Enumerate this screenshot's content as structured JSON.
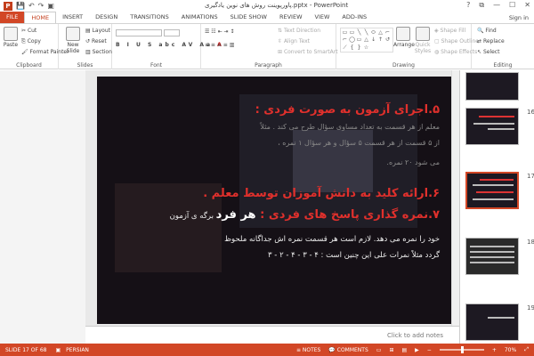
{
  "window": {
    "title": "پاورپوینت روش های نوین یادگیری.pptx - PowerPoint",
    "controls": [
      "?",
      "⧉",
      "—",
      "☐",
      "✕"
    ],
    "sign_in": "Sign in"
  },
  "qat": {
    "app_icon": "P",
    "save": "💾",
    "undo": "↶",
    "redo": "↷",
    "present": "▣"
  },
  "tabs": [
    "FILE",
    "HOME",
    "INSERT",
    "DESIGN",
    "TRANSITIONS",
    "ANIMATIONS",
    "SLIDE SHOW",
    "REVIEW",
    "VIEW",
    "ADD-INS"
  ],
  "ribbon": {
    "clipboard": {
      "paste": "Paste",
      "cut": "Cut",
      "copy": "Copy",
      "format_painter": "Format Painter",
      "label": "Clipboard"
    },
    "slides": {
      "new_slide": "New Slide",
      "layout": "Layout",
      "reset": "Reset",
      "section": "Section",
      "label": "Slides"
    },
    "font": {
      "label": "Font",
      "format_buttons": [
        "B",
        "I",
        "U",
        "S",
        "abc",
        "AV",
        "Aa",
        "A"
      ]
    },
    "paragraph": {
      "text_direction": "Text Direction",
      "align_text": "Align Text",
      "convert_smartart": "Convert to SmartArt",
      "label": "Paragraph"
    },
    "drawing": {
      "arrange": "Arrange",
      "quick_styles": "Quick Styles",
      "shape_fill": "Shape Fill",
      "shape_outline": "Shape Outline",
      "shape_effects": "Shape Effects",
      "label": "Drawing",
      "shapes": [
        "▭",
        "▭",
        "╲",
        "╲",
        "⬭",
        "△",
        "⌐",
        "⌐",
        "◯",
        "▭",
        "△",
        "↓",
        "↑",
        "↺",
        "⟋",
        "{",
        "}",
        "☆"
      ]
    },
    "editing": {
      "find": "Find",
      "replace": "Replace",
      "select": "Select",
      "label": "Editing"
    }
  },
  "slide": {
    "lines": [
      {
        "text": "۵.اجرای آزمون به صورت فردی :",
        "style": "red"
      },
      {
        "text": "معلم از هر قسمت به تعداد مساوی سؤال طرح می کند . مثلاً",
        "style": "grey"
      },
      {
        "text": "از ۵ قسمت از هر قسمت ۵ سؤال و هر سؤال ۱ نمره ،",
        "style": "grey"
      },
      {
        "text": "می شود ۲۰ نمره.",
        "style": "grey"
      },
      {
        "text": "۶.ارائه کلید به دانش آموزان توسط معلم .",
        "style": "red"
      },
      {
        "text": "۷.نمره گذاری پاسخ های فردی : هر فرد برگه ی آزمون",
        "style": "red-mixed"
      },
      {
        "text": "خود را نمره می دهد. لازم است هر قسمت نمره اش جداگانه ملحوظ",
        "style": "white"
      },
      {
        "text": "گردد مثلاً نمرات علی این چنین است : ۴ - ۳ - ۴ - ۲ - ۳",
        "style": "white"
      }
    ],
    "line7_red": "۷.نمره گذاری پاسخ های فردی :",
    "line7_bold": " هر فرد",
    "line7_rest": " برگه ی آزمون"
  },
  "notes_placeholder": "Click to add notes",
  "thumbnails": [
    {
      "num": "16"
    },
    {
      "num": "17"
    },
    {
      "num": "18"
    },
    {
      "num": "19"
    }
  ],
  "status": {
    "slide_info": "SLIDE 17 OF 68",
    "language": "PERSIAN",
    "notes": "NOTES",
    "comments": "COMMENTS",
    "zoom": "70%"
  },
  "colors": {
    "accent": "#d24726",
    "slide_bg": "#151016",
    "heading_red": "#e0302c"
  }
}
